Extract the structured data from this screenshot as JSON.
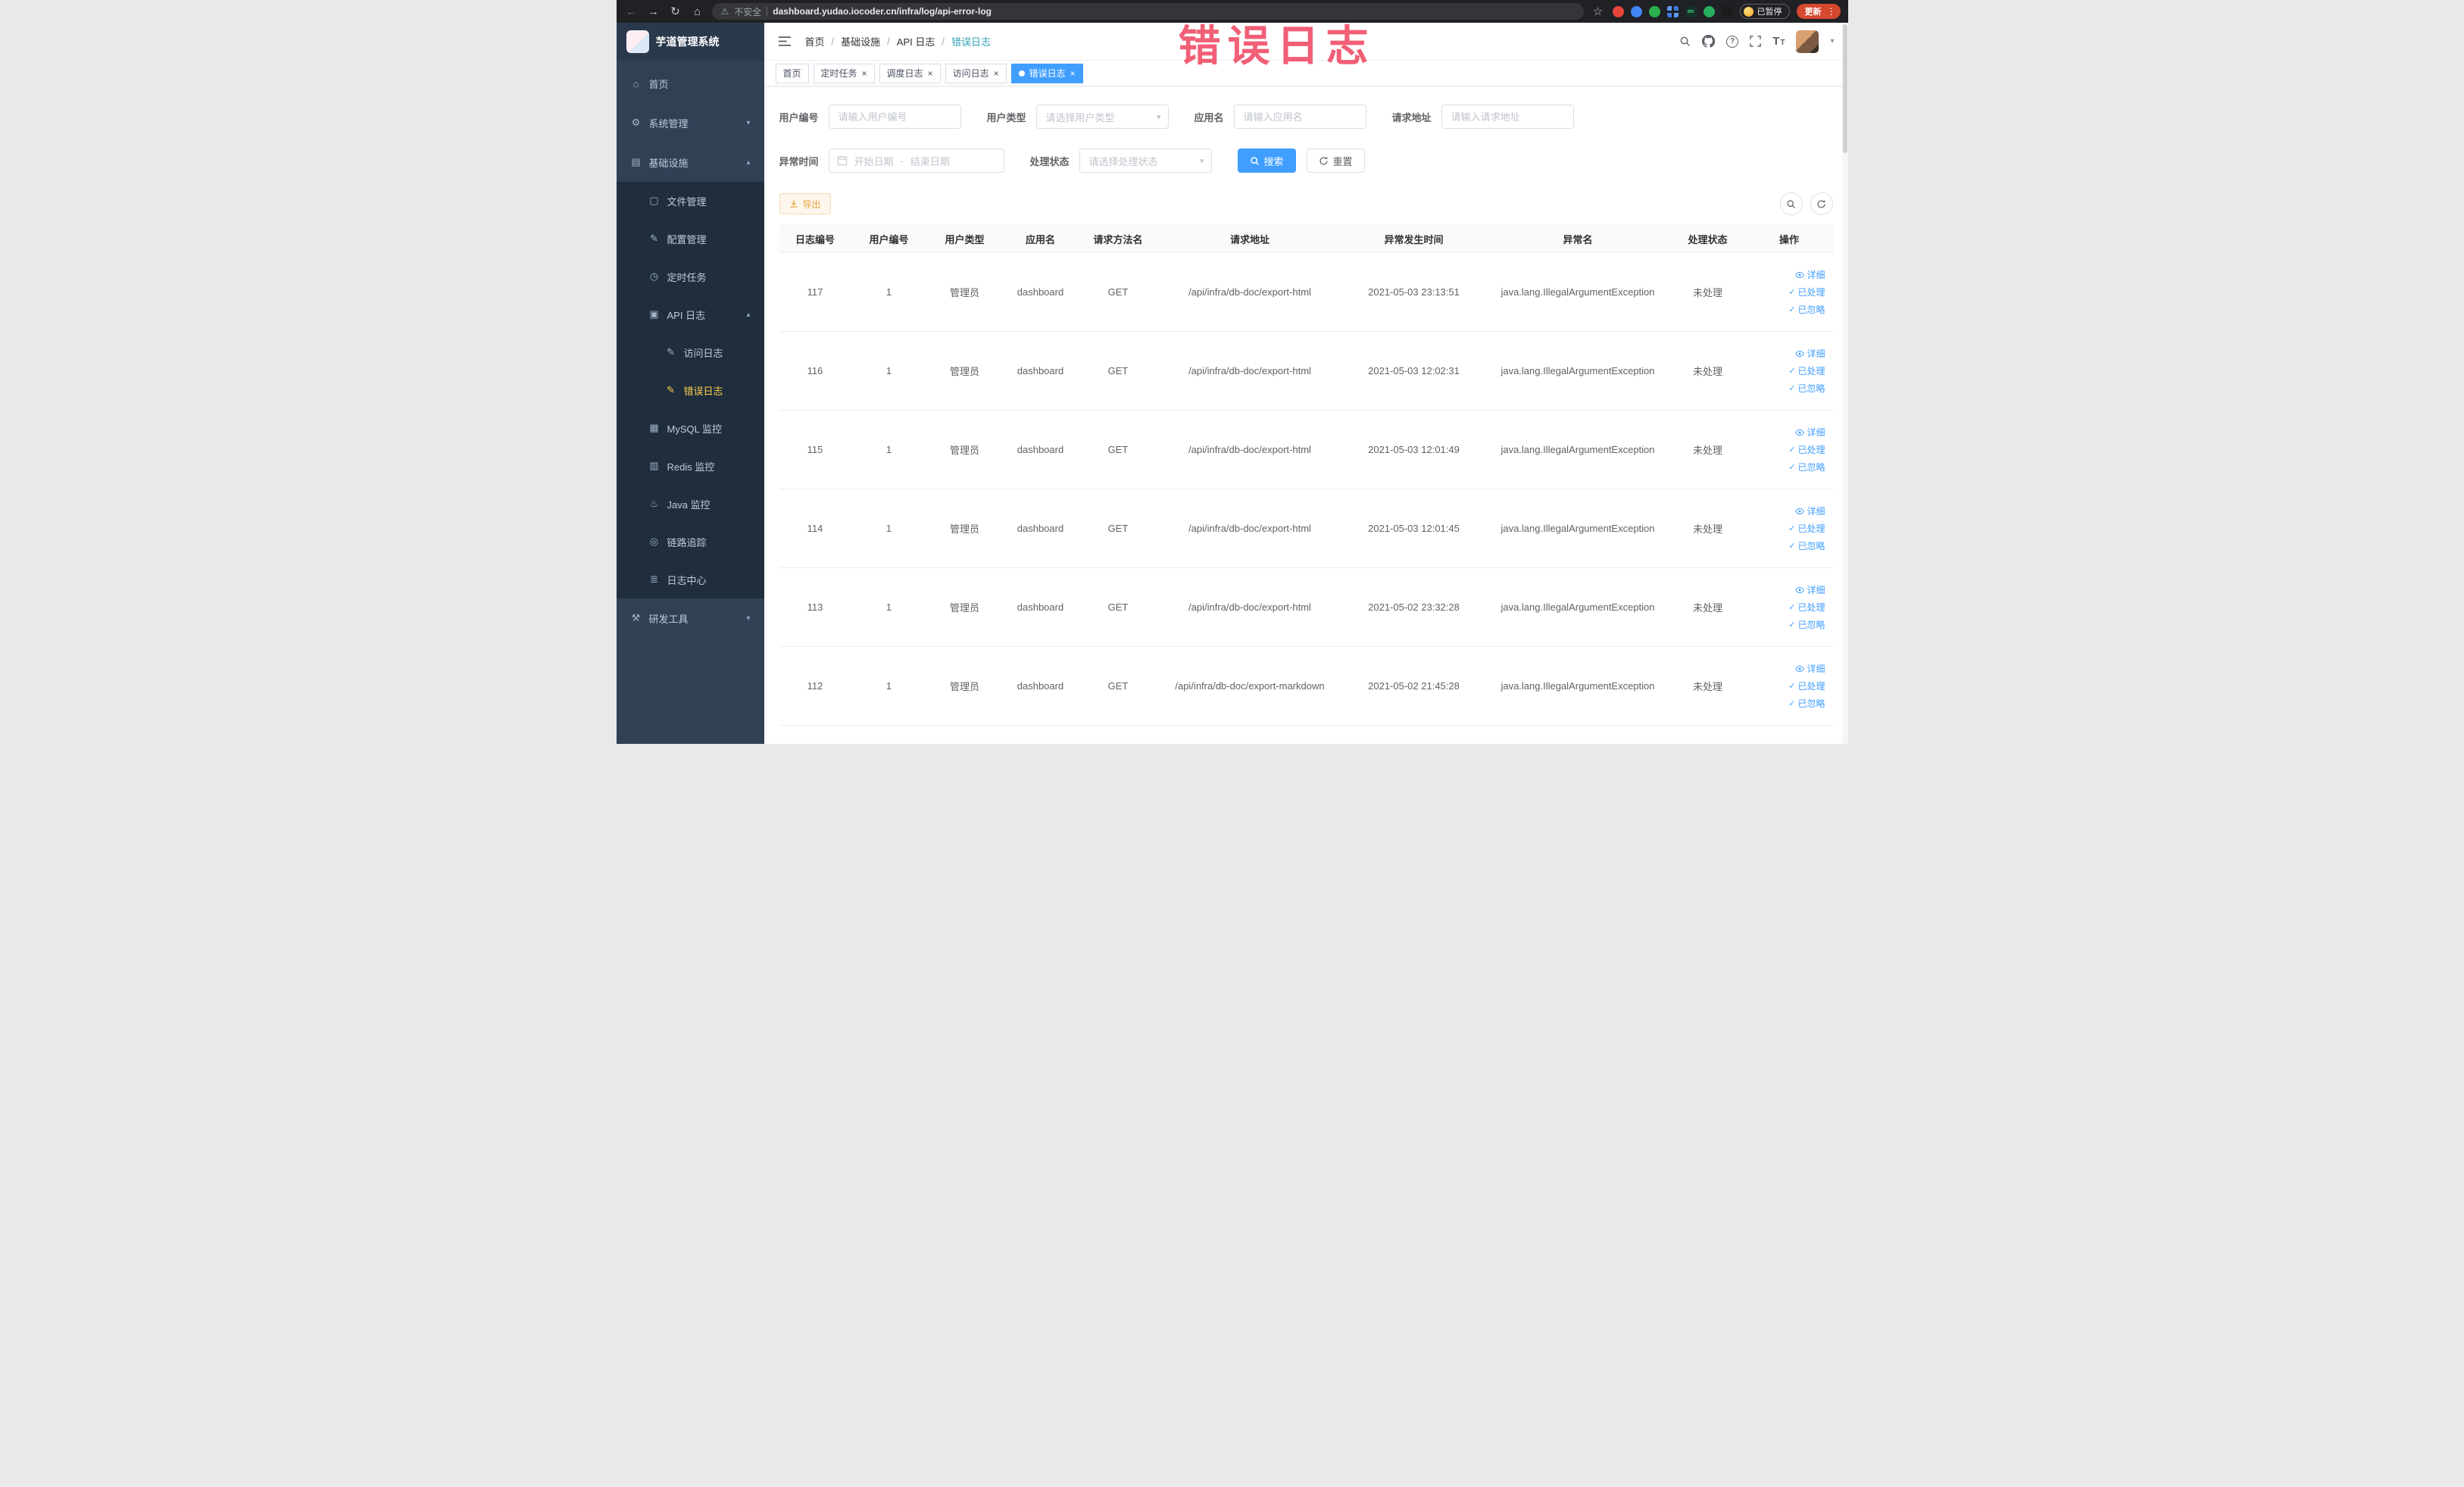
{
  "browser": {
    "security_label": "不安全",
    "url": "dashboard.yudao.iocoder.cn/infra/log/api-error-log",
    "on_badge": "on",
    "paused_label": "已暂停",
    "update_label": "更新"
  },
  "annotation": {
    "text": "错误日志"
  },
  "icon_glyphs": {
    "back": "←",
    "forward": "→",
    "reload": "↻",
    "browser_home": "⌂",
    "warning": "⚠",
    "star": "☆",
    "kebab": "⋮",
    "close": "×",
    "chevron-down": "▾",
    "chevron-up": "▴",
    "caret-down": "▾",
    "question": "?",
    "size_t": "T",
    "check": "✓",
    "home": "⌂",
    "gear": "⚙",
    "infrastructure": "▤",
    "file": "▢",
    "config": "✎",
    "timer": "◷",
    "api-log": "▣",
    "access-log": "✎",
    "error-log": "✎",
    "mysql": "▦",
    "redis": "▥",
    "java": "♨",
    "trace": "◎",
    "log-center": "≣",
    "tools": "⚒"
  },
  "sidebar": {
    "logo_title": "芋道管理系统",
    "items": [
      {
        "label": "首页",
        "icon": "home",
        "level": 1
      },
      {
        "label": "系统管理",
        "icon": "gear",
        "level": 1,
        "arrow": "down"
      },
      {
        "label": "基础设施",
        "icon": "infrastructure",
        "level": 1,
        "arrow": "up"
      },
      {
        "label": "文件管理",
        "icon": "file",
        "level": 2
      },
      {
        "label": "配置管理",
        "icon": "config",
        "level": 2
      },
      {
        "label": "定时任务",
        "icon": "timer",
        "level": 2
      },
      {
        "label": "API 日志",
        "icon": "api-log",
        "level": 2,
        "arrow": "up"
      },
      {
        "label": "访问日志",
        "icon": "access-log",
        "level": 3
      },
      {
        "label": "错误日志",
        "icon": "error-log",
        "level": 3,
        "active": true
      },
      {
        "label": "MySQL 监控",
        "icon": "mysql",
        "level": 2
      },
      {
        "label": "Redis 监控",
        "icon": "redis",
        "level": 2
      },
      {
        "label": "Java 监控",
        "icon": "java",
        "level": 2
      },
      {
        "label": "链路追踪",
        "icon": "trace",
        "level": 2
      },
      {
        "label": "日志中心",
        "icon": "log-center",
        "level": 2
      },
      {
        "label": "研发工具",
        "icon": "tools",
        "level": 1,
        "arrow": "down"
      }
    ]
  },
  "header": {
    "separator": "/",
    "breadcrumb": [
      {
        "label": "首页"
      },
      {
        "label": "基础设施"
      },
      {
        "label": "API 日志"
      },
      {
        "label": "错误日志",
        "current": true
      }
    ]
  },
  "tabs": [
    {
      "label": "首页"
    },
    {
      "label": "定时任务",
      "closable": true
    },
    {
      "label": "调度日志",
      "closable": true
    },
    {
      "label": "访问日志",
      "closable": true
    },
    {
      "label": "错误日志",
      "closable": true,
      "active": true
    }
  ],
  "filters": {
    "user_id": {
      "label": "用户编号",
      "placeholder": "请输入用户编号"
    },
    "user_type": {
      "label": "用户类型",
      "placeholder": "请选择用户类型"
    },
    "app_name": {
      "label": "应用名",
      "placeholder": "请输入应用名"
    },
    "request_url": {
      "label": "请求地址",
      "placeholder": "请输入请求地址"
    },
    "exception_time": {
      "label": "异常时间",
      "start_placeholder": "开始日期",
      "separator": "-",
      "end_placeholder": "结束日期"
    },
    "process_status": {
      "label": "处理状态",
      "placeholder": "请选择处理状态"
    },
    "search_label": "搜索",
    "reset_label": "重置"
  },
  "toolbar": {
    "export_label": "导出"
  },
  "table": {
    "columns": [
      {
        "label": "日志编号"
      },
      {
        "label": "用户编号"
      },
      {
        "label": "用户类型"
      },
      {
        "label": "应用名"
      },
      {
        "label": "请求方法名"
      },
      {
        "label": "请求地址"
      },
      {
        "label": "异常发生时间"
      },
      {
        "label": "异常名"
      },
      {
        "label": "处理状态"
      },
      {
        "label": "操作"
      }
    ],
    "rows": [
      {
        "id": "117",
        "user_id": "1",
        "user_type": "管理员",
        "app_name": "dashboard",
        "method": "GET",
        "url": "/api/infra/db-doc/export-html",
        "time": "2021-05-03 23:13:51",
        "exception": "java.lang.IllegalArgumentException",
        "status": "未处理"
      },
      {
        "id": "116",
        "user_id": "1",
        "user_type": "管理员",
        "app_name": "dashboard",
        "method": "GET",
        "url": "/api/infra/db-doc/export-html",
        "time": "2021-05-03 12:02:31",
        "exception": "java.lang.IllegalArgumentException",
        "status": "未处理"
      },
      {
        "id": "115",
        "user_id": "1",
        "user_type": "管理员",
        "app_name": "dashboard",
        "method": "GET",
        "url": "/api/infra/db-doc/export-html",
        "time": "2021-05-03 12:01:49",
        "exception": "java.lang.IllegalArgumentException",
        "status": "未处理"
      },
      {
        "id": "114",
        "user_id": "1",
        "user_type": "管理员",
        "app_name": "dashboard",
        "method": "GET",
        "url": "/api/infra/db-doc/export-html",
        "time": "2021-05-03 12:01:45",
        "exception": "java.lang.IllegalArgumentException",
        "status": "未处理"
      },
      {
        "id": "113",
        "user_id": "1",
        "user_type": "管理员",
        "app_name": "dashboard",
        "method": "GET",
        "url": "/api/infra/db-doc/export-html",
        "time": "2021-05-02 23:32:28",
        "exception": "java.lang.IllegalArgumentException",
        "status": "未处理"
      },
      {
        "id": "112",
        "user_id": "1",
        "user_type": "管理员",
        "app_name": "dashboard",
        "method": "GET",
        "url": "/api/infra/db-doc/export-markdown",
        "time": "2021-05-02 21:45:28",
        "exception": "java.lang.IllegalArgumentException",
        "status": "未处理"
      }
    ],
    "row_actions": {
      "detail": "详细",
      "processed": "已处理",
      "ignored": "已忽略"
    }
  }
}
